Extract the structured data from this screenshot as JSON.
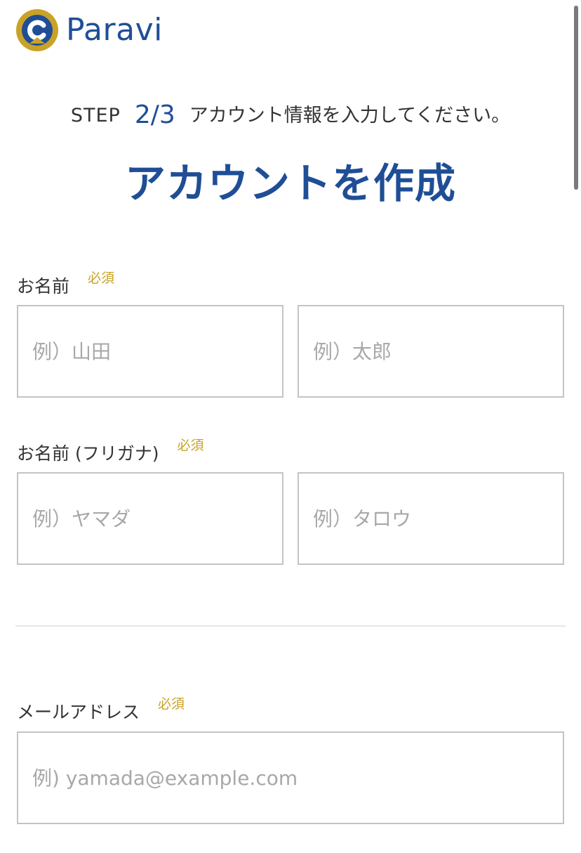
{
  "brand": {
    "name": "Paravi",
    "color": "#1f4e96",
    "accent": "#c9a227",
    "logo_icon": "paravi-logo-icon"
  },
  "step": {
    "label": "STEP",
    "current": "2/3",
    "instruction": "アカウント情報を入力してください。"
  },
  "title": "アカウントを作成",
  "form": {
    "name": {
      "label": "お名前",
      "required": "必須",
      "last_placeholder": "例）山田",
      "first_placeholder": "例）太郎"
    },
    "name_kana": {
      "label": "お名前 (フリガナ)",
      "required": "必須",
      "last_placeholder": "例）ヤマダ",
      "first_placeholder": "例）タロウ"
    },
    "email": {
      "label": "メールアドレス",
      "required": "必須",
      "placeholder": "例) yamada@example.com"
    }
  }
}
